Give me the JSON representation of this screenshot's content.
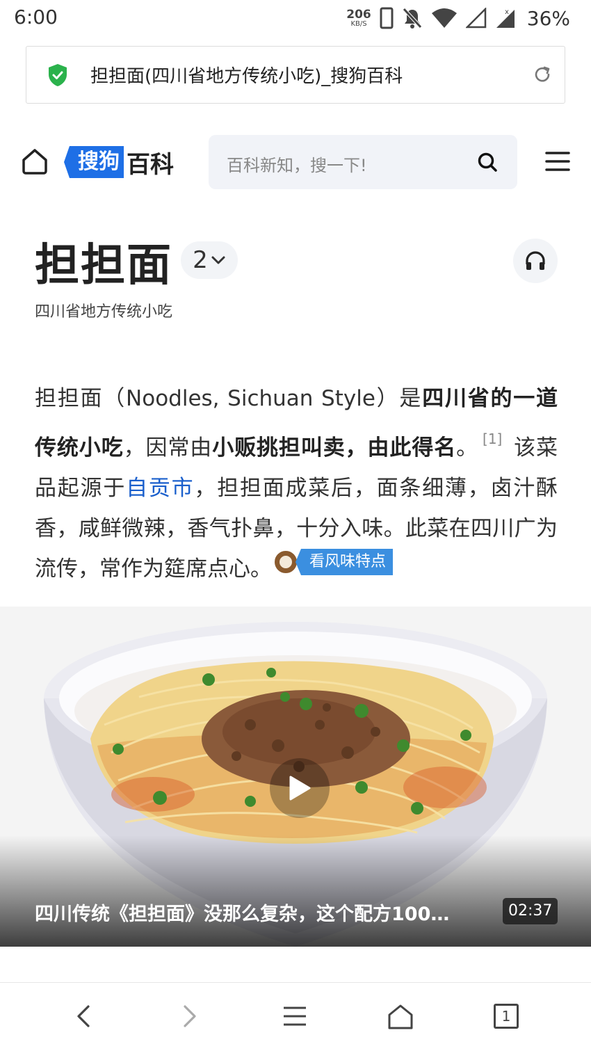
{
  "status_bar": {
    "time": "6:00",
    "net_speed_value": "206",
    "net_speed_unit": "KB/S",
    "battery": "36%"
  },
  "browser": {
    "page_title": "担担面(四川省地方传统小吃)_搜狗百科"
  },
  "header": {
    "logo_highlight": "搜狗",
    "logo_rest": "百科",
    "search_placeholder": "百科新知，搜一下!"
  },
  "entry": {
    "title": "担担面",
    "version_count": "2",
    "subtitle": "四川省地方传统小吃"
  },
  "intro": {
    "p1": "担担面（Noodles, Sichuan Style）是",
    "b1": "四川省的一道传统小吃",
    "p2": "，因常由",
    "b2": "小贩挑担叫卖，由此得名",
    "p3": "。",
    "ref": "[1]",
    "p4": " 该菜品起源于",
    "link": "自贡市",
    "p5": "，担担面成菜后，面条细薄，卤汁酥香，咸鲜微辣，香气扑鼻，十分入味。此菜在四川广为流传，常作为筵席点心。",
    "flavor_tag": "看风味特点"
  },
  "video": {
    "title": "四川传统《担担面》没那么复杂，这个配方100…",
    "duration": "02:37"
  },
  "bottom_nav": {
    "tab_count": "1"
  },
  "colors": {
    "brand_blue": "#1e6fe6",
    "link_blue": "#1a5fcc",
    "tag_blue": "#3b8fe0",
    "shield_green": "#2bb24c"
  }
}
